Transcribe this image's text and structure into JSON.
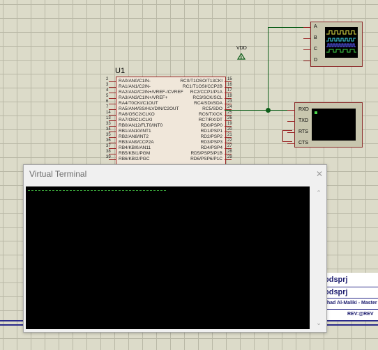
{
  "schematic": {
    "chip": {
      "label": "U1",
      "left_pins": [
        {
          "num": "2",
          "name": "RA0/AN0/C1IN-"
        },
        {
          "num": "3",
          "name": "RA1/AN1/C2IN-"
        },
        {
          "num": "4",
          "name": "RA2/AN2/C2IN+/VREF-/CVREF"
        },
        {
          "num": "5",
          "name": "RA3/AN3/C1IN+/VREF+"
        },
        {
          "num": "6",
          "name": "RA4/T0CKI/C1OUT"
        },
        {
          "num": "7",
          "name": "RA5/AN4/SS/HLVDIN/C2OUT"
        },
        {
          "num": "14",
          "name": "RA6/OSC2/CLKO"
        },
        {
          "num": "13",
          "name": "RA7/OSC1/CLKI"
        },
        {
          "num": "33",
          "name": "RB0/AN12/FLT0/INT0"
        },
        {
          "num": "34",
          "name": "RB1/AN10/INT1"
        },
        {
          "num": "35",
          "name": "RB2/AN8/INT2"
        },
        {
          "num": "36",
          "name": "RB3/AN9/CCP2A"
        },
        {
          "num": "37",
          "name": "RB4/KBI0/AN11"
        },
        {
          "num": "38",
          "name": "RB5/KBI1/PGM"
        },
        {
          "num": "39",
          "name": "RB6/KBI2/PGC"
        }
      ],
      "right_pins": [
        {
          "num": "15",
          "name": "RC0/T1OSO/T13CKI"
        },
        {
          "num": "16",
          "name": "RC1/T1OSI/CCP2B"
        },
        {
          "num": "17",
          "name": "RC2/CCP1/P1A"
        },
        {
          "num": "18",
          "name": "RC3/SCK/SCL"
        },
        {
          "num": "23",
          "name": "RC4/SDI/SDA"
        },
        {
          "num": "24",
          "name": "RC5/SDO"
        },
        {
          "num": "25",
          "name": "RC6/TX/CK"
        },
        {
          "num": "26",
          "name": "RC7/RX/DT"
        },
        {
          "num": "19",
          "name": "RD0/PSP0"
        },
        {
          "num": "20",
          "name": "RD1/PSP1"
        },
        {
          "num": "21",
          "name": "RD2/PSP2"
        },
        {
          "num": "22",
          "name": "RD3/PSP3"
        },
        {
          "num": "27",
          "name": "RD4/PSP4"
        },
        {
          "num": "28",
          "name": "RD5/PSP5/P1B"
        },
        {
          "num": "29",
          "name": "RD6/PSP6/P1C"
        }
      ]
    },
    "vdd_label": "VDD",
    "scope_channels": [
      "A",
      "B",
      "C",
      "D"
    ],
    "terminal_pins": [
      "RXD",
      "TXD",
      "RTS",
      "CTS"
    ],
    "title_block": {
      "line1": "odsprj",
      "line2": "odsprj",
      "line3": "ahad Al-Maliki - Master",
      "rev": "REV:@REV"
    },
    "colors": {
      "wire": "#0d5e19",
      "pin": "#9b2525",
      "sheet": "#dcdbc9"
    }
  },
  "terminal_window": {
    "title": "Virtual Terminal",
    "close_icon": "close-icon",
    "scroll_up_icon": "chevron-up-icon",
    "scroll_down_icon": "chevron-down-icon"
  }
}
